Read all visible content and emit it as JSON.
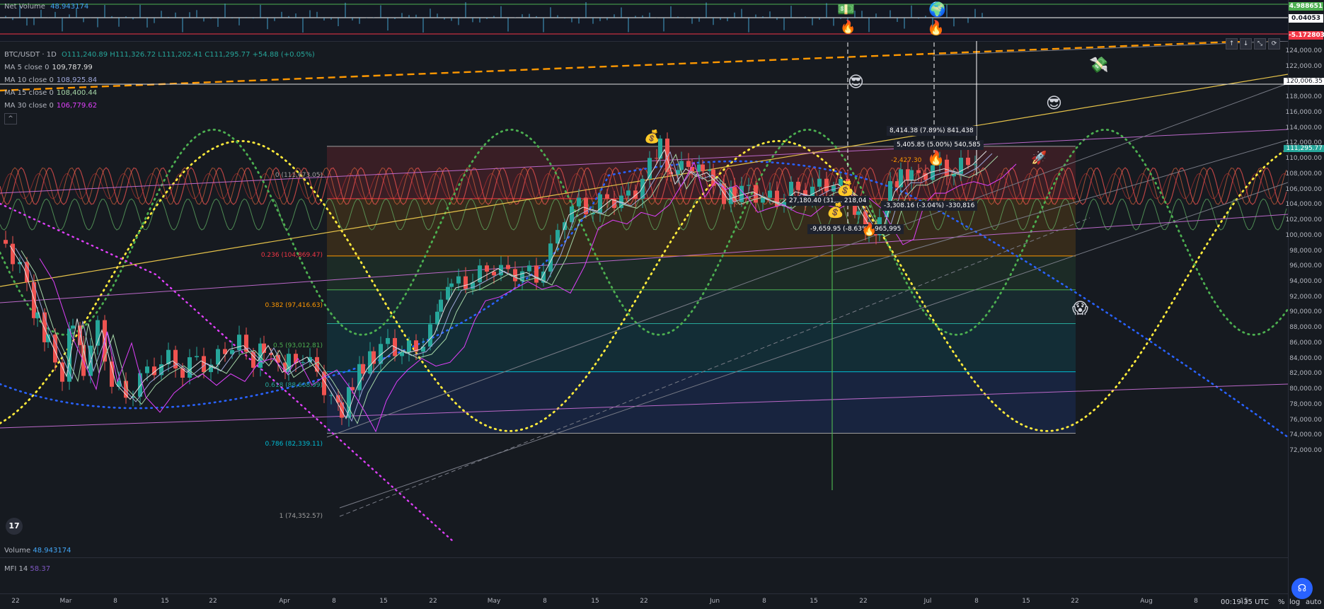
{
  "top_indicator": {
    "label": "Net Volume",
    "value": "48.943174"
  },
  "symbol": {
    "name": "BTC/USDT · 1D",
    "ohlc": "O111,240.89 H111,326.72 L111,202.41 C111,295.77 +54.88 (+0.05%)"
  },
  "mas": [
    {
      "label": "MA 5 close 0",
      "value": "109,787.99",
      "color": "#e0e0e0"
    },
    {
      "label": "MA 10 close 0",
      "value": "108,925.84",
      "color": "#9fa8da"
    },
    {
      "label": "MA 15 close 0",
      "value": "108,400.44",
      "color": "#a5d6a7"
    },
    {
      "label": "MA 30 close 0",
      "value": "106,779.62",
      "color": "#e040fb"
    }
  ],
  "top_scale": [
    {
      "value": "4.988651",
      "color": "#4caf50"
    },
    {
      "value": "0.04053",
      "color": "#ffffff"
    },
    {
      "value": "-5.172803",
      "color": "#f23645"
    }
  ],
  "price_ticks": [
    "124,000.00",
    "122,000.00",
    "120,006.35",
    "118,000.00",
    "116,000.00",
    "114,000.00",
    "112,000.00",
    "111,295.77",
    "110,000.00",
    "108,000.00",
    "106,000.00",
    "104,000.00",
    "102,000.00",
    "100,000.00",
    "98,000.00",
    "96,000.00",
    "94,000.00",
    "92,000.00",
    "90,000.00",
    "88,000.00",
    "86,000.00",
    "84,000.00",
    "82,000.00",
    "80,000.00",
    "78,000.00",
    "76,000.00",
    "74,000.00",
    "72,000.00"
  ],
  "current_price": "111,295.77",
  "highlight_price": "120,006.35",
  "fib_levels": [
    {
      "label": "0 (111,673.05)",
      "color": "#9e9e9e"
    },
    {
      "label": "0.236 (104,869.47)",
      "color": "#f23645"
    },
    {
      "label": "0.382 (97,416.63)",
      "color": "#ff9800"
    },
    {
      "label": "0.5 (93,012.81)",
      "color": "#4caf50"
    },
    {
      "label": "0.618 (88,608.99)",
      "color": "#26a69a"
    },
    {
      "label": "0.786 (82,339.11)",
      "color": "#00bcd4"
    },
    {
      "label": "1 (74,352.57)",
      "color": "#9e9e9e"
    }
  ],
  "measure_labels": [
    "8,414.38 (7.89%) 841,438",
    "5,405.85 (5.00%) 540,585",
    "27,180.40 (31,... 218,04",
    "-3,308.16 (-3.04%) -330,816",
    "-9,659.95 (-8.63%) -965,995",
    "-2,427.30"
  ],
  "x_ticks": [
    "22",
    "Mar",
    "8",
    "15",
    "22",
    "Apr",
    "8",
    "15",
    "22",
    "May",
    "8",
    "15",
    "22",
    "Jun",
    "8",
    "15",
    "22",
    "Jul",
    "8",
    "15",
    "22",
    "Aug",
    "8",
    "15"
  ],
  "volume": {
    "label": "Volume",
    "value": "48.943174"
  },
  "mfi": {
    "label": "MFI 14",
    "value": "58.37"
  },
  "footer": {
    "time": "00:19:35 UTC",
    "pct": "%",
    "log": "log",
    "auto": "auto"
  },
  "toolbar_icons": [
    "arrow-up-icon",
    "arrow-down-icon",
    "collapse-icon",
    "settings-icon"
  ],
  "colors": {
    "up": "#26a69a",
    "down": "#ef5350",
    "bg": "#161a20"
  }
}
